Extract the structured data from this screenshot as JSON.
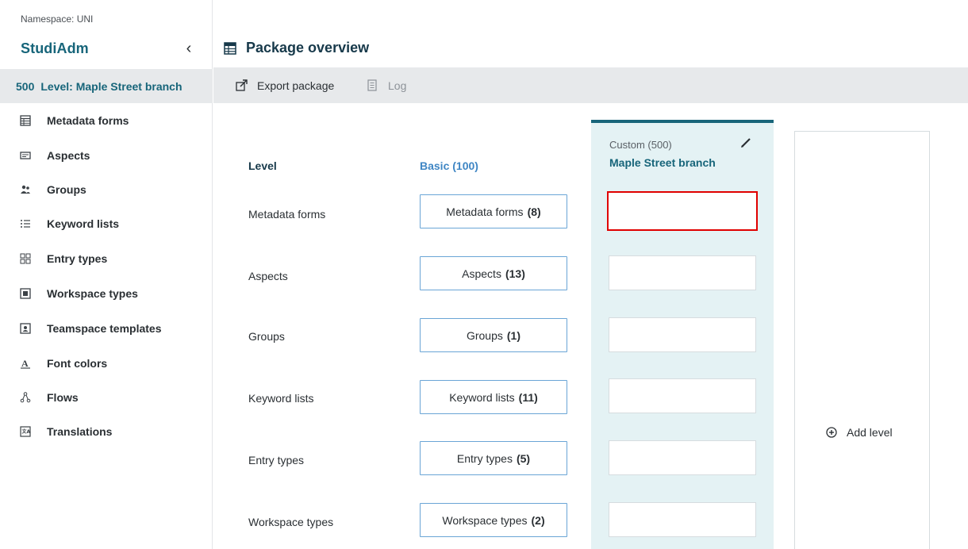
{
  "sidebar": {
    "namespace": "Namespace: UNI",
    "app_title": "StudiAdm",
    "collapse_glyph": "‹",
    "level": {
      "number": "500",
      "label": "Level: Maple Street branch"
    },
    "items": [
      {
        "label": "Metadata forms",
        "icon": "table-icon"
      },
      {
        "label": "Aspects",
        "icon": "aspects-icon"
      },
      {
        "label": "Groups",
        "icon": "groups-icon"
      },
      {
        "label": "Keyword lists",
        "icon": "list-icon"
      },
      {
        "label": "Entry types",
        "icon": "entry-types-icon"
      },
      {
        "label": "Workspace types",
        "icon": "workspace-icon"
      },
      {
        "label": "Teamspace templates",
        "icon": "teamspace-icon"
      },
      {
        "label": "Font colors",
        "icon": "font-color-icon"
      },
      {
        "label": "Flows",
        "icon": "flows-icon"
      },
      {
        "label": "Translations",
        "icon": "translations-icon"
      }
    ]
  },
  "header": {
    "title": "Package overview"
  },
  "toolbar": {
    "export_label": "Export package",
    "log_label": "Log"
  },
  "grid": {
    "level_header": "Level",
    "basic_header": "Basic (100)",
    "custom_sub": "Custom (500)",
    "custom_name": "Maple Street branch",
    "rows": [
      {
        "label": "Metadata forms",
        "button": "Metadata forms",
        "count": "(8)"
      },
      {
        "label": "Aspects",
        "button": "Aspects",
        "count": "(13)"
      },
      {
        "label": "Groups",
        "button": "Groups",
        "count": "(1)"
      },
      {
        "label": "Keyword lists",
        "button": "Keyword lists",
        "count": "(11)"
      },
      {
        "label": "Entry types",
        "button": "Entry types",
        "count": "(5)"
      },
      {
        "label": "Workspace types",
        "button": "Workspace types",
        "count": "(2)"
      }
    ],
    "add_level": "Add level"
  },
  "colors": {
    "accent": "#17657a",
    "link": "#3f86c4",
    "custom_bg": "#e4f2f4",
    "highlight": "#e00000"
  }
}
